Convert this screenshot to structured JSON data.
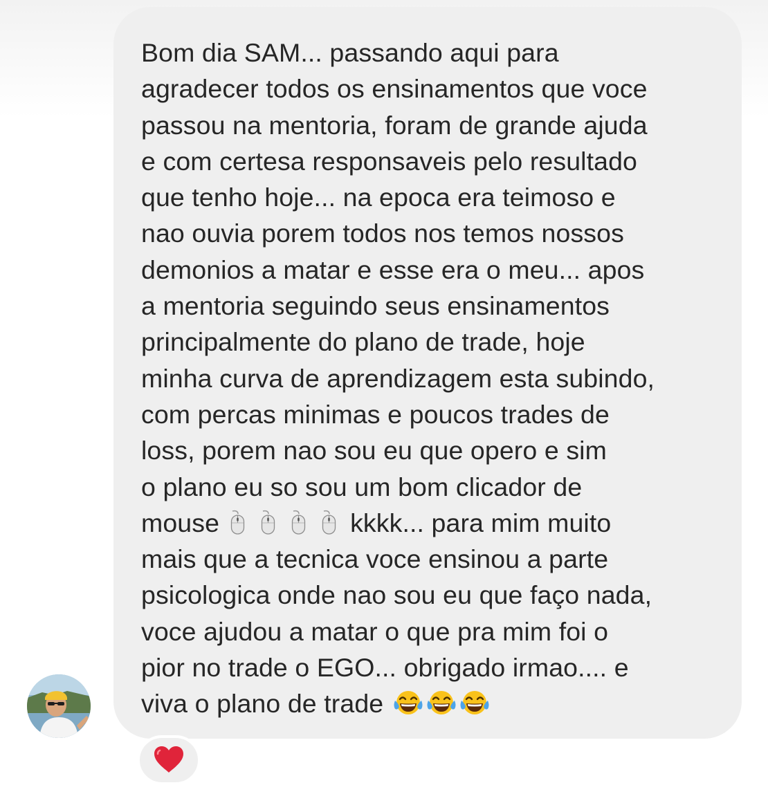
{
  "message": {
    "lines": [
      "Bom dia SAM... passando aqui para",
      "agradecer todos os ensinamentos que voce",
      "passou na mentoria, foram de grande ajuda",
      "e com certesa responsaveis pelo resultado",
      "que tenho hoje... na epoca era teimoso e",
      "nao ouvia porem todos nos temos nossos",
      "demonios a matar e esse era o meu... apos",
      "a mentoria seguindo seus ensinamentos",
      "principalmente do plano de trade, hoje",
      "minha curva de aprendizagem esta subindo,",
      "com percas minimas e poucos trades de",
      "loss, porem nao sou eu que opero e sim",
      "o plano eu so sou um bom clicador de"
    ],
    "line14_before": "mouse",
    "line14_after": "kkkk... para mim muito",
    "lines_after": [
      "mais que a tecnica voce ensinou a parte",
      "psicologica onde nao sou eu que faço nada,",
      "voce ajudou a matar o que pra mim foi o",
      "pior no trade o EGO... obrigado irmao.... e"
    ],
    "last_line": "viva o plano de trade",
    "inline_emoji": {
      "mouse_icon": "computer-mouse",
      "mouse_count": 4,
      "laugh_icon": "face-with-tears-of-joy",
      "laugh_count": 3
    }
  },
  "reaction": {
    "icon": "red-heart",
    "color": "#e0243a"
  },
  "colors": {
    "bubble_bg": "#efefef",
    "text": "#262626",
    "page_bg": "#ffffff"
  }
}
